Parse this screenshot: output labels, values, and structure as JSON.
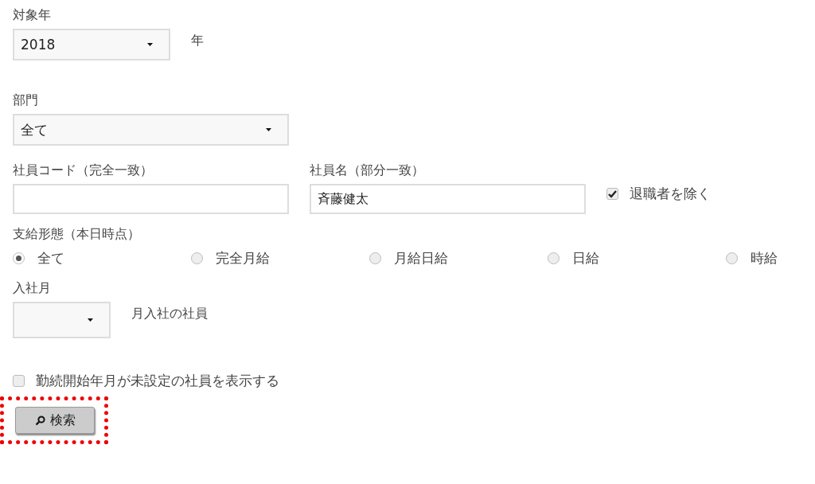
{
  "target_year": {
    "label": "対象年",
    "value": "2018",
    "suffix": "年"
  },
  "department": {
    "label": "部門",
    "value": "全て"
  },
  "employee_code": {
    "label": "社員コード（完全一致）"
  },
  "employee_name": {
    "label": "社員名（部分一致）",
    "value": "斉藤健太"
  },
  "exclude_retired": {
    "label": "退職者を除く",
    "checked": true
  },
  "pay_type": {
    "label": "支給形態（本日時点）",
    "options": [
      {
        "label": "全て",
        "selected": true
      },
      {
        "label": "完全月給",
        "selected": false
      },
      {
        "label": "月給日給",
        "selected": false
      },
      {
        "label": "日給",
        "selected": false
      },
      {
        "label": "時給",
        "selected": false
      }
    ]
  },
  "join_month": {
    "label": "入社月",
    "suffix": "月入社の社員"
  },
  "show_unset": {
    "label": "勤続開始年月が未設定の社員を表示する",
    "checked": false
  },
  "search_button": {
    "label": "検索",
    "highlighted": true
  }
}
